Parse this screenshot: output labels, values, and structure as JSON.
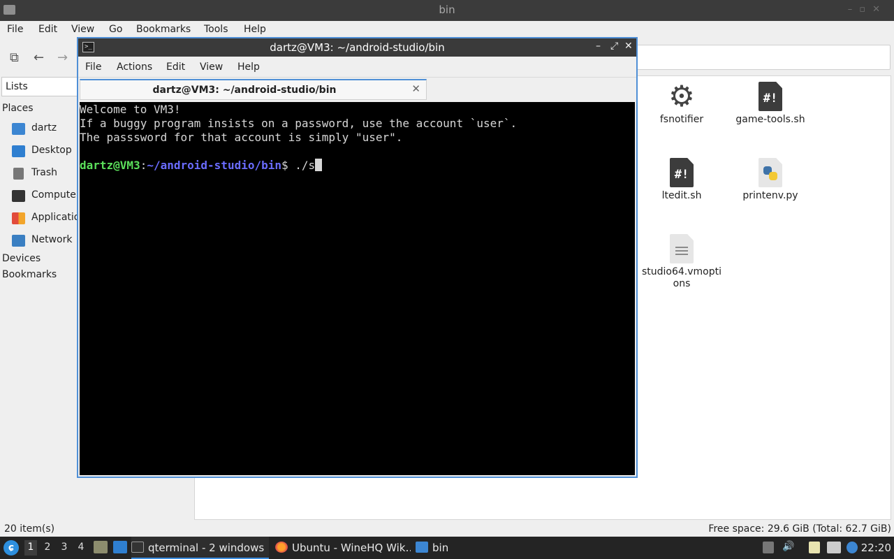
{
  "file_manager": {
    "title": "bin",
    "menu": [
      "File",
      "Edit",
      "View",
      "Go",
      "Bookmarks",
      "Tools",
      "Help"
    ],
    "sidebar": {
      "selector": "Lists",
      "places_header": "Places",
      "places": [
        {
          "label": "dartz",
          "icon": "home-folder-icon"
        },
        {
          "label": "Desktop",
          "icon": "desktop-icon"
        },
        {
          "label": "Trash",
          "icon": "trash-icon"
        },
        {
          "label": "Computer",
          "icon": "computer-icon"
        },
        {
          "label": "Applications",
          "icon": "applications-icon"
        },
        {
          "label": "Network",
          "icon": "network-icon"
        }
      ],
      "devices_header": "Devices",
      "bookmarks_header": "Bookmarks"
    },
    "files": [
      {
        "name": "fsnotifier",
        "icon": "gear-icon"
      },
      {
        "name": "game-tools.sh",
        "icon": "shell-script-icon",
        "mark": "#!"
      },
      {
        "name": "ltedit.sh",
        "icon": "shell-script-icon",
        "mark": "#!"
      },
      {
        "name": "printenv.py",
        "icon": "python-file-icon"
      },
      {
        "name": "studio64.vmoptions",
        "icon": "text-file-icon"
      }
    ],
    "status": {
      "items": "20 item(s)",
      "free_space": "Free space: 29.6 GiB (Total: 62.7 GiB)"
    }
  },
  "terminal": {
    "title": "dartz@VM3: ~/android-studio/bin",
    "menu": [
      "File",
      "Actions",
      "Edit",
      "View",
      "Help"
    ],
    "tab_label": "dartz@VM3: ~/android-studio/bin",
    "output_lines": [
      "Welcome to VM3!",
      "If a buggy program insists on a password, use the account `user`.",
      "The passsword for that account is simply \"user\"."
    ],
    "prompt": {
      "user_host": "dartz@VM3",
      "separator": ":",
      "path": "~/android-studio/bin",
      "symbol": "$",
      "command": " ./s"
    }
  },
  "taskbar": {
    "workspaces": [
      "1",
      "2",
      "3",
      "4"
    ],
    "active_workspace": "1",
    "tasks": [
      {
        "label": "qterminal - 2 windows",
        "icon": "terminal-icon",
        "active": true
      },
      {
        "label": "Ubuntu - WineHQ Wik…",
        "icon": "firefox-icon",
        "active": false
      },
      {
        "label": "bin",
        "icon": "folder-icon",
        "active": false
      }
    ],
    "clock": "22:20"
  },
  "colors": {
    "accent": "#4f8fd6",
    "prompt_user": "#5be05b",
    "prompt_path": "#6a6cff",
    "terminal_bg": "#000000"
  }
}
